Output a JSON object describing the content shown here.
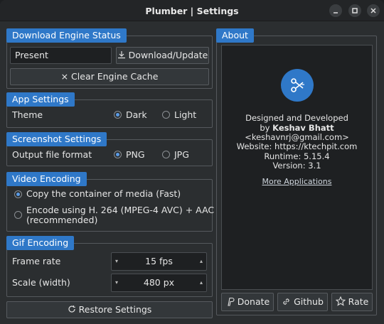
{
  "window": {
    "title": "Plumber | Settings"
  },
  "engine": {
    "group_title": "Download Engine Status",
    "status_value": "Present",
    "download_label": "Download/Update",
    "clear_label": "Clear Engine Cache"
  },
  "app_settings": {
    "group_title": "App Settings",
    "theme_label": "Theme",
    "options": [
      "Dark",
      "Light"
    ],
    "selected": "Dark"
  },
  "screenshot": {
    "group_title": "Screenshot Settings",
    "format_label": "Output file format",
    "options": [
      "PNG",
      "JPG"
    ],
    "selected": "PNG"
  },
  "video": {
    "group_title": "Video Encoding",
    "option1": "Copy the container of media (Fast)",
    "option2_line1": "Encode using H. 264 (MPEG-4 AVC) + AAC",
    "option2_line2": "(recommended)",
    "selected": "option1"
  },
  "gif": {
    "group_title": "Gif Encoding",
    "frame_rate_label": "Frame rate",
    "frame_rate_value": "15 fps",
    "scale_label": "Scale (width)",
    "scale_value": "480 px"
  },
  "restore_label": "Restore Settings",
  "about": {
    "group_title": "About",
    "line1": "Designed and Developed",
    "line2_prefix": "by ",
    "author": "Keshav Bhatt",
    "email": "<keshavnrj@gmail.com>",
    "website": "Website: https://ktechpit.com",
    "runtime": "Runtime: 5.15.4",
    "version": "Version: 3.1",
    "more_apps": "More Applications",
    "donate_label": "Donate",
    "github_label": "Github",
    "rate_label": "Rate"
  },
  "colors": {
    "accent": "#2f78c8",
    "background": "#2b2e30"
  }
}
